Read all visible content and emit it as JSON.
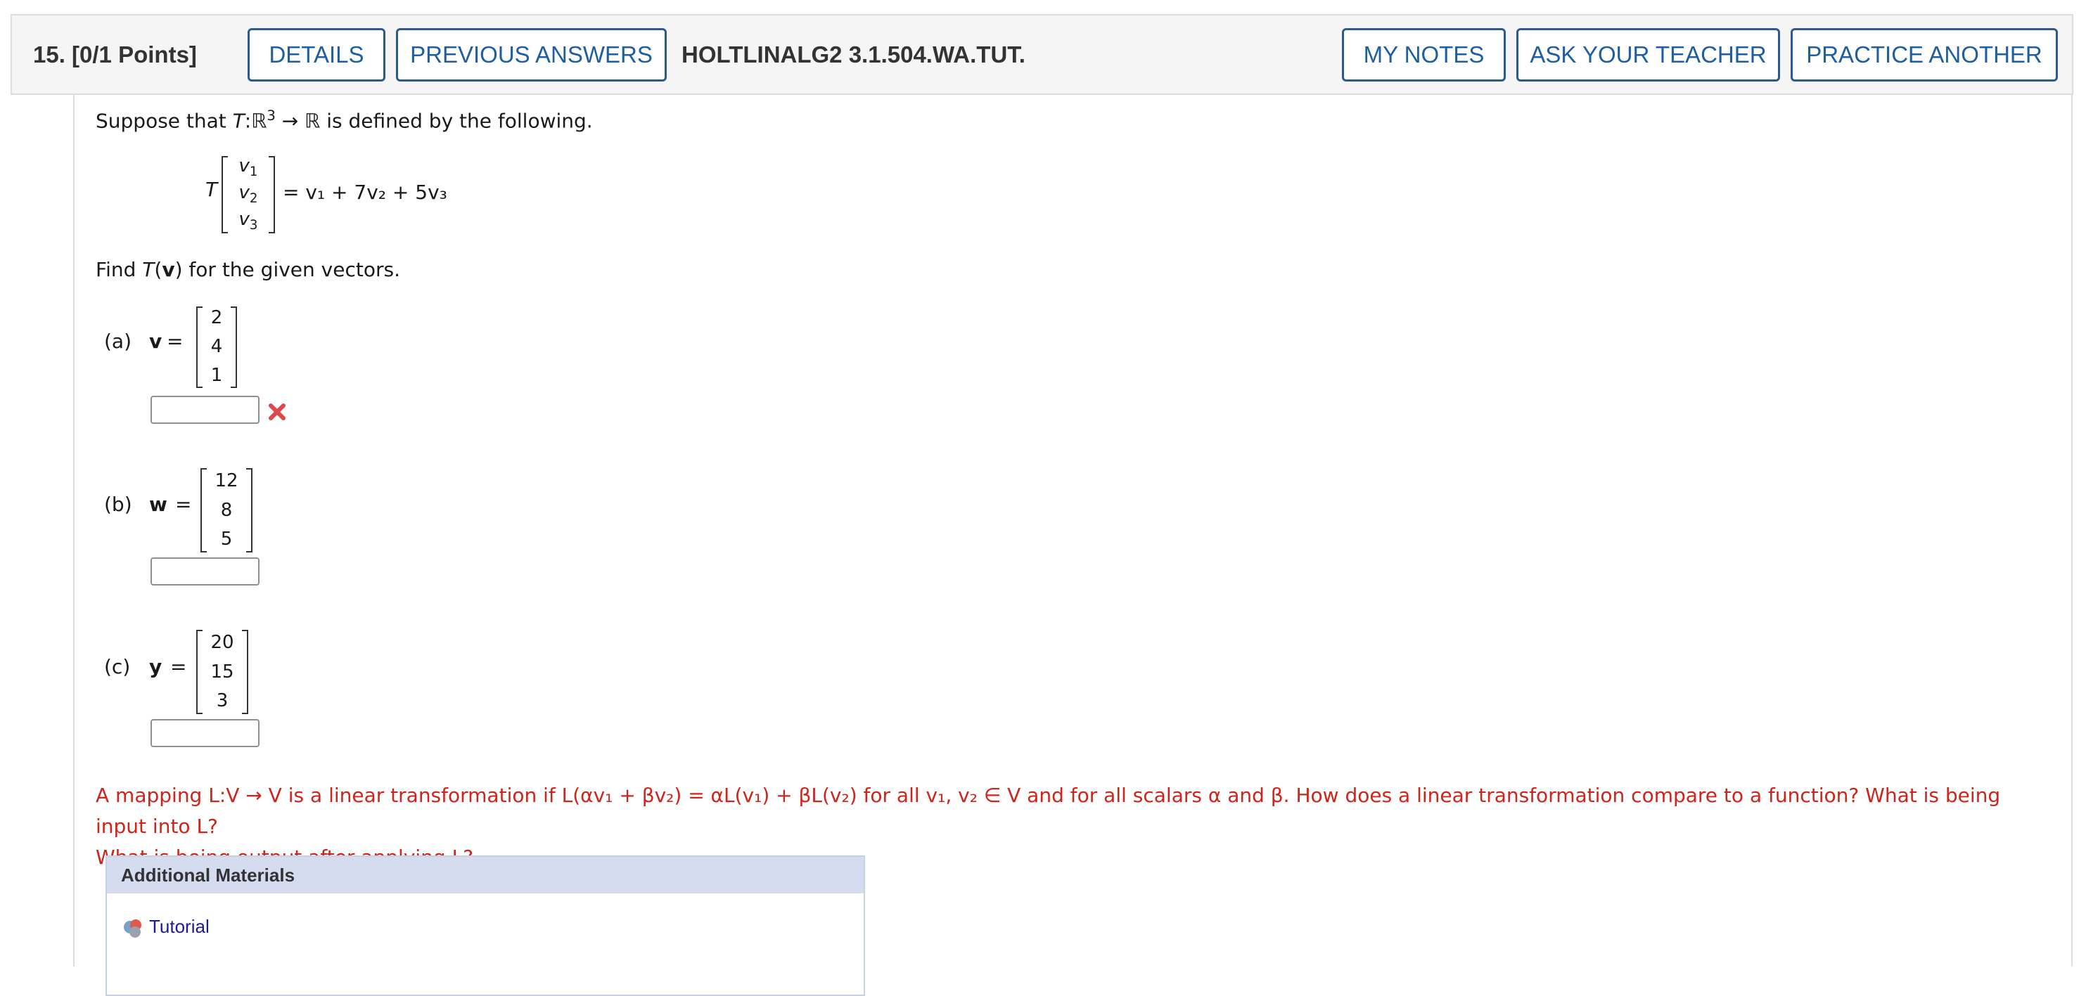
{
  "header": {
    "question_number": "15.",
    "points": "[0/1 Points]",
    "details_label": "DETAILS",
    "previous_answers_label": "PREVIOUS ANSWERS",
    "question_code": "HOLTLINALG2 3.1.504.WA.TUT.",
    "my_notes_label": "MY NOTES",
    "ask_teacher_label": "ASK YOUR TEACHER",
    "practice_another_label": "PRACTICE ANOTHER"
  },
  "problem": {
    "intro_prefix": "Suppose that ",
    "intro_map": "T",
    "intro_domain": "ℝ",
    "intro_exp": "3",
    "intro_arrow": "→ ℝ",
    "intro_suffix": " is defined by the following.",
    "definition_func": "T",
    "definition_vector": [
      "v",
      "v",
      "v"
    ],
    "definition_vector_subs": [
      "1",
      "2",
      "3"
    ],
    "definition_rhs": "= v₁ + 7v₂ + 5v₃",
    "find_prefix": "Find ",
    "find_func": "T",
    "find_arg": "v",
    "find_suffix": " for the given vectors."
  },
  "parts": [
    {
      "label": "(a)",
      "var": "v",
      "vector": [
        "2",
        "4",
        "1"
      ],
      "answer": "",
      "status": "incorrect"
    },
    {
      "label": "(b)",
      "var": "w",
      "vector": [
        "12",
        "8",
        "5"
      ],
      "answer": "",
      "status": "none"
    },
    {
      "label": "(c)",
      "var": "y",
      "vector": [
        "20",
        "15",
        "3"
      ],
      "answer": "",
      "status": "none"
    }
  ],
  "hint": {
    "line1": "A mapping L:V → V is a linear transformation if L(αv₁ + βv₂) = αL(v₁) + βL(v₂) for all v₁, v₂ ∈ V and for all scalars α and β. How does a linear transformation compare to a function? What is being input into L?",
    "line2": "What is being output after applying L?"
  },
  "additional_materials": {
    "title": "Additional Materials",
    "tutorial_label": "Tutorial"
  },
  "colors": {
    "button_border": "#2b5a8c",
    "button_text": "#1f5fa0",
    "hint_red": "#d0231a",
    "incorrect_x": "#e0474c"
  },
  "icons": {
    "incorrect": "x-mark-icon",
    "tutorial": "tutorial-icon"
  }
}
